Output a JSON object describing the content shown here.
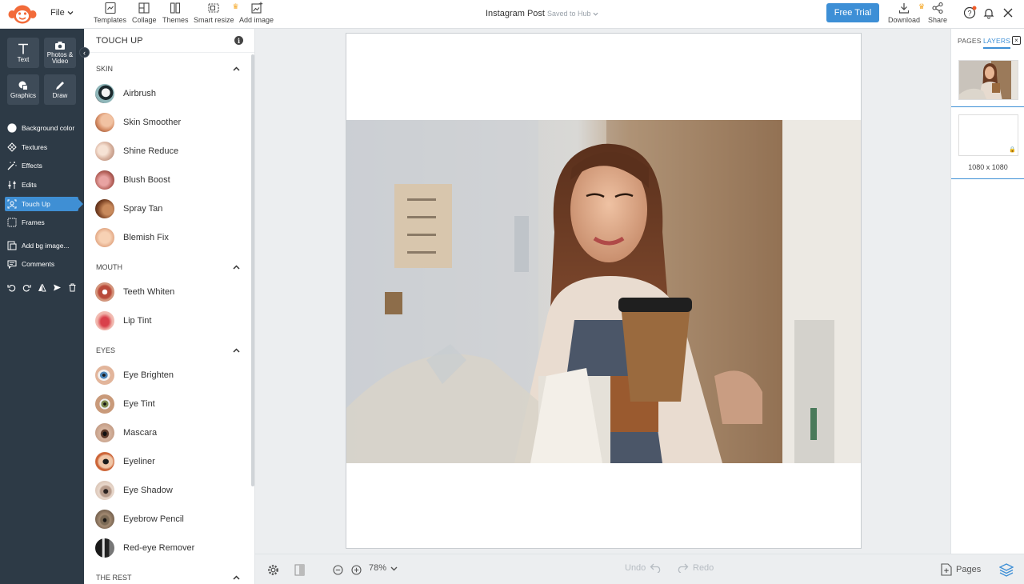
{
  "app": {
    "file_menu": "File",
    "doc_title": "Instagram Post",
    "save_status": "Saved to Hub",
    "free_trial": "Free Trial"
  },
  "toolbar": [
    {
      "label": "Templates",
      "icon": "templates-icon"
    },
    {
      "label": "Collage",
      "icon": "collage-icon"
    },
    {
      "label": "Themes",
      "icon": "themes-icon"
    },
    {
      "label": "Smart resize",
      "icon": "smart-resize-icon",
      "premium": true
    },
    {
      "label": "Add image",
      "icon": "add-image-icon"
    }
  ],
  "top_right": {
    "download": "Download",
    "share": "Share"
  },
  "rail": {
    "buttons": [
      {
        "label": "Text",
        "icon": "text-icon"
      },
      {
        "label": "Photos & Video",
        "icon": "camera-icon"
      },
      {
        "label": "Graphics",
        "icon": "graphics-icon"
      },
      {
        "label": "Draw",
        "icon": "pen-icon"
      }
    ],
    "items": [
      {
        "label": "Background color",
        "icon": "circle-icon",
        "active": false
      },
      {
        "label": "Textures",
        "icon": "textures-icon",
        "active": false
      },
      {
        "label": "Effects",
        "icon": "effects-icon",
        "active": false
      },
      {
        "label": "Edits",
        "icon": "edits-icon",
        "active": false
      },
      {
        "label": "Touch Up",
        "icon": "touch-up-icon",
        "active": true
      },
      {
        "label": "Frames",
        "icon": "frames-icon",
        "active": false
      },
      {
        "label": "Add bg image...",
        "icon": "add-bg-image-icon",
        "active": false
      },
      {
        "label": "Comments",
        "icon": "comments-icon",
        "active": false
      }
    ]
  },
  "panel": {
    "title": "TOUCH UP",
    "sections": [
      {
        "name": "SKIN",
        "items": [
          "Airbrush",
          "Skin Smoother",
          "Shine Reduce",
          "Blush Boost",
          "Spray Tan",
          "Blemish Fix"
        ]
      },
      {
        "name": "MOUTH",
        "items": [
          "Teeth Whiten",
          "Lip Tint"
        ]
      },
      {
        "name": "EYES",
        "items": [
          "Eye Brighten",
          "Eye Tint",
          "Mascara",
          "Eyeliner",
          "Eye Shadow",
          "Eyebrow Pencil",
          "Red-eye Remover"
        ]
      },
      {
        "name": "THE REST",
        "items": []
      }
    ]
  },
  "bottom": {
    "zoom": "78%",
    "undo": "Undo",
    "redo": "Redo",
    "pages": "Pages"
  },
  "right_panel": {
    "tab_pages": "PAGES",
    "tab_layers": "LAYERS",
    "layer_size": "1080 x 1080"
  },
  "colors": {
    "accent": "#3d8fd6",
    "rail_bg": "#2d3a46",
    "logo": "#f26b3a"
  }
}
